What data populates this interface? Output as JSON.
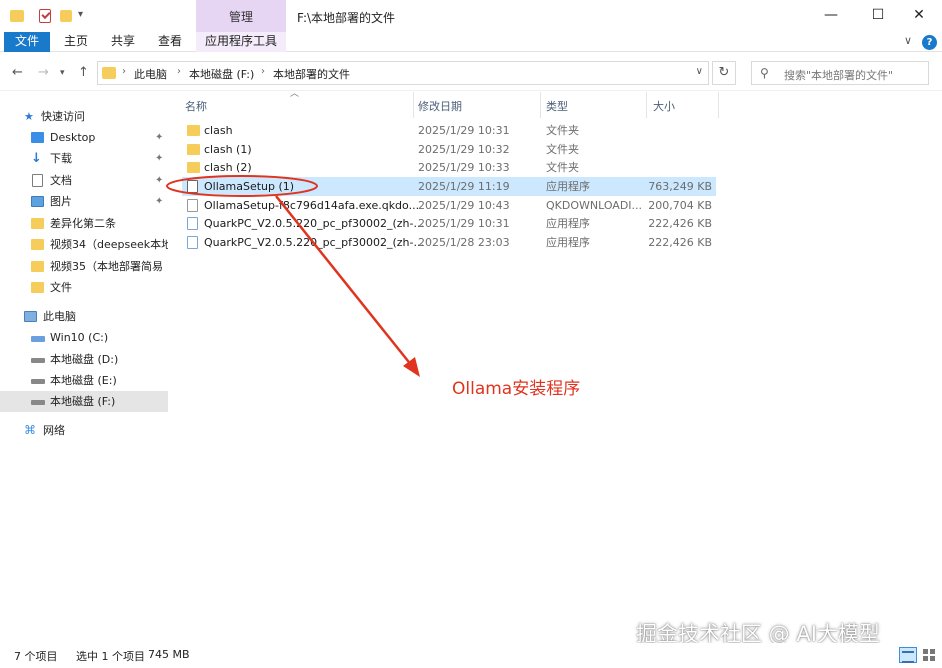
{
  "window": {
    "title": "F:\\本地部署的文件",
    "context_tab": "管理",
    "min": "—",
    "max": "☐",
    "close": "✕"
  },
  "ribbon": {
    "tabs": [
      "文件",
      "主页",
      "共享",
      "查看",
      "应用程序工具"
    ],
    "chevron": "∨",
    "help": "?"
  },
  "address": {
    "crumbs": [
      "此电脑",
      "本地磁盘 (F:)",
      "本地部署的文件"
    ],
    "separator": "›",
    "search_placeholder": "搜索\"本地部署的文件\""
  },
  "sidebar": {
    "items": [
      {
        "label": "快速访问",
        "icon": "star-icon",
        "pinned": false
      },
      {
        "label": "Desktop",
        "icon": "desktop-icon",
        "pinned": true
      },
      {
        "label": "下载",
        "icon": "download-icon",
        "pinned": true
      },
      {
        "label": "文档",
        "icon": "document-icon",
        "pinned": true
      },
      {
        "label": "图片",
        "icon": "picture-icon",
        "pinned": true
      },
      {
        "label": "差异化第二条",
        "icon": "folder-icon",
        "pinned": false
      },
      {
        "label": "视频34（deepseek本地",
        "icon": "folder-icon",
        "pinned": false
      },
      {
        "label": "视频35（本地部署简易",
        "icon": "folder-icon",
        "pinned": false
      },
      {
        "label": "文件",
        "icon": "folder-icon",
        "pinned": false
      },
      {
        "label": "此电脑",
        "icon": "computer-icon",
        "pinned": false
      },
      {
        "label": "Win10 (C:)",
        "icon": "windows-drive-icon",
        "pinned": false
      },
      {
        "label": "本地磁盘 (D:)",
        "icon": "drive-icon",
        "pinned": false
      },
      {
        "label": "本地磁盘 (E:)",
        "icon": "drive-icon",
        "pinned": false
      },
      {
        "label": "本地磁盘 (F:)",
        "icon": "drive-icon",
        "pinned": false,
        "selected": true
      },
      {
        "label": "网络",
        "icon": "network-icon",
        "pinned": false
      }
    ]
  },
  "columns": {
    "name": "名称",
    "date": "修改日期",
    "type": "类型",
    "size": "大小"
  },
  "files": [
    {
      "name": "clash",
      "date": "2025/1/29 10:31",
      "type": "文件夹",
      "size": "",
      "icon": "folder-icon"
    },
    {
      "name": "clash (1)",
      "date": "2025/1/29 10:32",
      "type": "文件夹",
      "size": "",
      "icon": "folder-icon"
    },
    {
      "name": "clash (2)",
      "date": "2025/1/29 10:33",
      "type": "文件夹",
      "size": "",
      "icon": "folder-icon"
    },
    {
      "name": "OllamaSetup (1)",
      "date": "2025/1/29 11:19",
      "type": "应用程序",
      "size": "763,249 KB",
      "icon": "exe-icon",
      "selected": true
    },
    {
      "name": "OllamaSetup-f8c796d14afa.exe.qkdo...",
      "date": "2025/1/29 10:43",
      "type": "QKDOWNLOADI...",
      "size": "200,704 KB",
      "icon": "file-icon"
    },
    {
      "name": "QuarkPC_V2.0.5.220_pc_pf30002_(zh-...",
      "date": "2025/1/29 10:31",
      "type": "应用程序",
      "size": "222,426 KB",
      "icon": "quark-icon"
    },
    {
      "name": "QuarkPC_V2.0.5.220_pc_pf30002_(zh-...",
      "date": "2025/1/28 23:03",
      "type": "应用程序",
      "size": "222,426 KB",
      "icon": "quark-icon"
    }
  ],
  "annotation": {
    "label": "Ollama安装程序",
    "color": "#e0341f"
  },
  "status": {
    "count": "7 个项目",
    "selection": "选中 1 个项目",
    "size": "745 MB"
  },
  "watermark": "掘金技术社区 @ AI大模型",
  "colors": {
    "accent": "#1979ca",
    "selection": "#cce8ff",
    "folder": "#f6cc5b",
    "context_tab": "#e7d6f3"
  }
}
